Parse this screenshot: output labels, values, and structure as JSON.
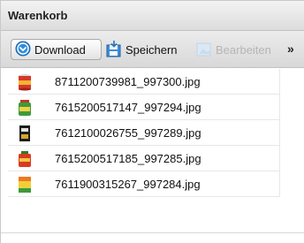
{
  "header": {
    "title": "Warenkorb"
  },
  "toolbar": {
    "download_label": "Download",
    "speichern_label": "Speichern",
    "bearbeiten_label": "Bearbeiten",
    "more_label": "»"
  },
  "files": [
    {
      "name": "8711200739981_997300.jpg",
      "thumb": "red-can-icon"
    },
    {
      "name": "7615200517147_997294.jpg",
      "thumb": "green-jar-icon"
    },
    {
      "name": "7612100026755_997289.jpg",
      "thumb": "black-package-icon"
    },
    {
      "name": "7615200517185_997285.jpg",
      "thumb": "red-jar-icon"
    },
    {
      "name": "7611900315267_997284.jpg",
      "thumb": "green-yellow-pack-icon"
    }
  ],
  "colors": {
    "download_icon": "#2f8de0",
    "disabled_text": "#b5b5b5"
  }
}
